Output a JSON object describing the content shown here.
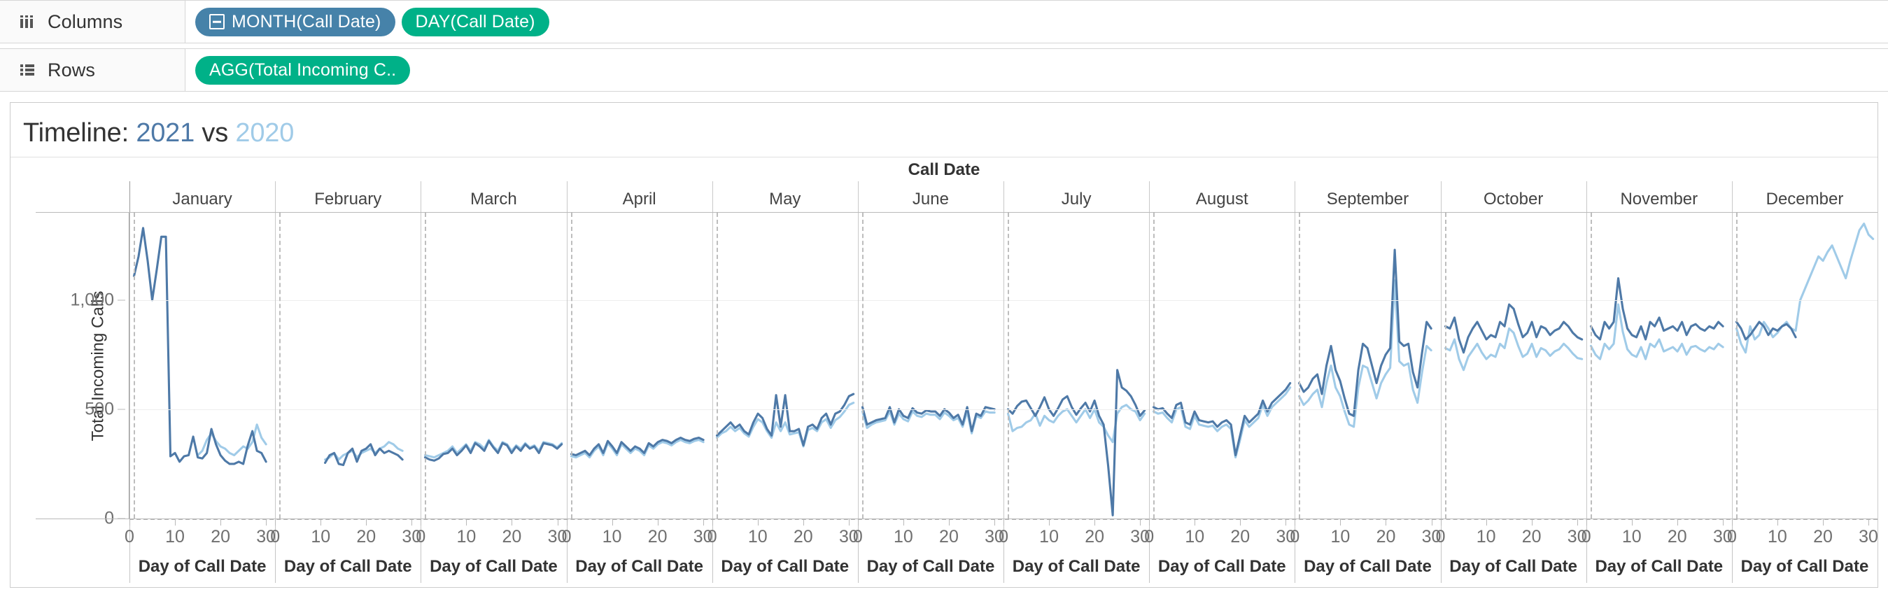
{
  "shelves": [
    {
      "name": "columns",
      "label": "Columns",
      "icon": "columns-icon",
      "pills": [
        {
          "label": "MONTH(Call Date)",
          "color": "#4682a9",
          "style": "blue",
          "glyph": "collapse-minus-icon"
        },
        {
          "label": "DAY(Call Date)",
          "color": "#00b188",
          "style": "green",
          "glyph": ""
        }
      ]
    },
    {
      "name": "rows",
      "label": "Rows",
      "icon": "rows-icon",
      "pills": [
        {
          "label": "AGG(Total Incoming C..",
          "color": "#00b188",
          "style": "green",
          "glyph": ""
        }
      ]
    }
  ],
  "title": {
    "prefix": "Timeline: ",
    "year_current": "2021",
    "separator": " vs ",
    "year_previous": "2020"
  },
  "colors": {
    "series_2021": "#4e79a7",
    "series_2020": "#a0cbe8",
    "pill_blue": "#4682a9",
    "pill_green": "#00b188",
    "gridline": "#ededed",
    "axis": "#b9b9b9",
    "text": "#333333",
    "tick_text": "#707070"
  },
  "chart_data": {
    "type": "line",
    "title": "Timeline: 2021 vs 2020",
    "xlabel": "Day of Call Date",
    "ylabel": "Total Incoming Calls",
    "column_field_label": "Call Date",
    "ylim": [
      0,
      1400
    ],
    "yticks": [
      0,
      500,
      1000
    ],
    "ytick_labels": [
      "0",
      "500",
      "1,000"
    ],
    "xlim": [
      0,
      32
    ],
    "xticks": [
      0,
      10,
      20,
      30
    ],
    "xtick_labels": [
      "0",
      "10",
      "20",
      "30"
    ],
    "grid": true,
    "legend": "none",
    "panel_field": "MONTH(Call Date)",
    "panels": [
      "January",
      "February",
      "March",
      "April",
      "May",
      "June",
      "July",
      "August",
      "September",
      "October",
      "November",
      "December"
    ],
    "panel_xlabels": [
      "Day of Call Date",
      "Day of Call Date",
      "Day of Call Date",
      "Day of Call Date",
      "Day of Call Date",
      "Day of Call Date",
      "Day of Call Date",
      "Day of Call Date",
      "Day of Call Date",
      "Day of Call Date",
      "Day of Call Date",
      "Day of Call Date"
    ],
    "series": [
      {
        "name": "2021",
        "color": "#4e79a7",
        "panel_values": {
          "January": [
            1110,
            1200,
            1330,
            1180,
            1000,
            1140,
            1290,
            1290,
            285,
            300,
            260,
            285,
            290,
            375,
            280,
            275,
            300,
            410,
            340,
            290,
            265,
            250,
            250,
            260,
            250,
            335,
            400,
            310,
            300,
            260
          ],
          "February": [
            null,
            null,
            null,
            null,
            null,
            null,
            null,
            null,
            null,
            null,
            255,
            290,
            300,
            250,
            245,
            300,
            320,
            260,
            310,
            320,
            340,
            290,
            320,
            300,
            310,
            300,
            290,
            270
          ],
          "March": [
            280,
            270,
            265,
            275,
            295,
            300,
            320,
            290,
            310,
            335,
            300,
            345,
            330,
            310,
            355,
            325,
            300,
            345,
            335,
            300,
            330,
            310,
            340,
            320,
            330,
            300,
            345,
            340,
            335,
            320,
            340
          ],
          "April": [
            295,
            290,
            300,
            310,
            290,
            320,
            340,
            300,
            355,
            330,
            300,
            350,
            330,
            310,
            330,
            320,
            300,
            345,
            330,
            350,
            360,
            355,
            345,
            360,
            370,
            360,
            355,
            365,
            370,
            360
          ],
          "May": [
            380,
            400,
            420,
            440,
            415,
            430,
            400,
            385,
            440,
            480,
            460,
            410,
            380,
            565,
            420,
            565,
            400,
            400,
            410,
            335,
            420,
            430,
            410,
            460,
            480,
            430,
            480,
            490,
            520,
            560,
            570
          ],
          "June": [
            510,
            430,
            440,
            450,
            455,
            460,
            510,
            440,
            500,
            470,
            460,
            505,
            485,
            480,
            495,
            490,
            490,
            470,
            500,
            485,
            460,
            475,
            430,
            510,
            400,
            480,
            470,
            510,
            505,
            500
          ],
          "July": [
            500,
            480,
            515,
            535,
            540,
            505,
            470,
            510,
            555,
            500,
            470,
            505,
            545,
            560,
            510,
            475,
            505,
            530,
            490,
            540,
            470,
            430,
            240,
            15,
            680,
            600,
            585,
            560,
            520,
            470,
            495
          ],
          "August": [
            510,
            500,
            505,
            480,
            460,
            520,
            530,
            440,
            430,
            490,
            450,
            445,
            440,
            445,
            420,
            440,
            450,
            430,
            290,
            380,
            470,
            440,
            460,
            480,
            540,
            490,
            530,
            550,
            570,
            590,
            620
          ],
          "September": [
            620,
            580,
            600,
            640,
            660,
            570,
            700,
            790,
            680,
            630,
            550,
            480,
            470,
            680,
            800,
            780,
            700,
            620,
            700,
            750,
            780,
            1230,
            810,
            790,
            800,
            670,
            600,
            760,
            900,
            870
          ],
          "October": [
            880,
            870,
            920,
            820,
            760,
            830,
            870,
            900,
            860,
            820,
            840,
            830,
            900,
            880,
            980,
            960,
            890,
            830,
            850,
            900,
            830,
            880,
            870,
            840,
            860,
            870,
            900,
            880,
            850,
            830,
            820
          ],
          "November": [
            880,
            840,
            820,
            900,
            870,
            900,
            1100,
            960,
            870,
            840,
            830,
            880,
            820,
            900,
            880,
            920,
            860,
            870,
            880,
            860,
            900,
            840,
            880,
            890,
            870,
            860,
            880,
            870,
            900,
            880
          ],
          "December": [
            900,
            870,
            820,
            840,
            870,
            900,
            880,
            840,
            870,
            860,
            880,
            890,
            870,
            830,
            null,
            null,
            null,
            null,
            null,
            null,
            null,
            null,
            null,
            null,
            null,
            null,
            null,
            null,
            null,
            null,
            null
          ]
        }
      },
      {
        "name": "2020",
        "color": "#a0cbe8",
        "panel_values": {
          "January": [
            null,
            null,
            null,
            null,
            null,
            null,
            null,
            null,
            null,
            null,
            null,
            null,
            null,
            null,
            290,
            310,
            360,
            390,
            355,
            330,
            320,
            300,
            290,
            310,
            330,
            320,
            350,
            430,
            370,
            340
          ],
          "February": [
            null,
            null,
            null,
            null,
            null,
            null,
            null,
            null,
            null,
            null,
            270,
            280,
            300,
            270,
            290,
            300,
            310,
            280,
            300,
            310,
            320,
            300,
            320,
            330,
            350,
            340,
            320,
            310
          ],
          "March": [
            290,
            285,
            280,
            290,
            300,
            310,
            330,
            300,
            320,
            340,
            310,
            350,
            340,
            320,
            360,
            330,
            310,
            350,
            340,
            310,
            335,
            320,
            345,
            325,
            335,
            310,
            350,
            345,
            340,
            325,
            345
          ],
          "April": [
            285,
            280,
            290,
            300,
            280,
            310,
            330,
            290,
            345,
            320,
            290,
            340,
            320,
            300,
            320,
            310,
            290,
            335,
            320,
            340,
            350,
            345,
            335,
            350,
            360,
            350,
            345,
            355,
            360,
            350
          ],
          "May": [
            370,
            390,
            400,
            420,
            400,
            415,
            390,
            375,
            420,
            455,
            440,
            400,
            370,
            440,
            400,
            440,
            385,
            390,
            395,
            330,
            405,
            415,
            400,
            440,
            455,
            415,
            450,
            465,
            490,
            520,
            530
          ],
          "June": [
            490,
            415,
            430,
            440,
            445,
            450,
            490,
            430,
            480,
            455,
            445,
            490,
            470,
            465,
            480,
            475,
            475,
            455,
            485,
            470,
            450,
            460,
            420,
            490,
            390,
            470,
            460,
            490,
            485,
            485
          ],
          "July": [
            480,
            400,
            415,
            420,
            440,
            450,
            480,
            425,
            470,
            450,
            440,
            470,
            490,
            500,
            470,
            440,
            470,
            500,
            460,
            500,
            440,
            420,
            380,
            350,
            480,
            510,
            520,
            500,
            490,
            450,
            480
          ],
          "August": [
            490,
            480,
            485,
            460,
            440,
            500,
            510,
            420,
            410,
            470,
            430,
            425,
            420,
            425,
            400,
            420,
            430,
            410,
            280,
            360,
            450,
            420,
            440,
            460,
            520,
            470,
            510,
            530,
            550,
            570,
            600
          ],
          "September": [
            560,
            520,
            540,
            570,
            590,
            510,
            620,
            700,
            600,
            560,
            490,
            430,
            420,
            600,
            700,
            690,
            620,
            550,
            620,
            660,
            690,
            1090,
            720,
            700,
            710,
            590,
            530,
            670,
            790,
            770
          ],
          "October": [
            780,
            770,
            820,
            730,
            680,
            740,
            770,
            800,
            760,
            730,
            750,
            740,
            800,
            780,
            870,
            850,
            790,
            740,
            755,
            800,
            740,
            780,
            770,
            745,
            765,
            775,
            800,
            780,
            755,
            735,
            730
          ],
          "November": [
            790,
            750,
            730,
            800,
            775,
            800,
            980,
            855,
            775,
            750,
            740,
            785,
            730,
            800,
            785,
            820,
            765,
            775,
            785,
            765,
            800,
            750,
            785,
            790,
            775,
            765,
            785,
            775,
            800,
            785
          ],
          "December": [
            870,
            800,
            760,
            880,
            820,
            840,
            900,
            870,
            830,
            850,
            880,
            900,
            870,
            860,
            1000,
            1050,
            1100,
            1150,
            1200,
            1180,
            1220,
            1250,
            1200,
            1150,
            1100,
            1180,
            1250,
            1320,
            1350,
            1300,
            1280
          ]
        }
      }
    ]
  }
}
